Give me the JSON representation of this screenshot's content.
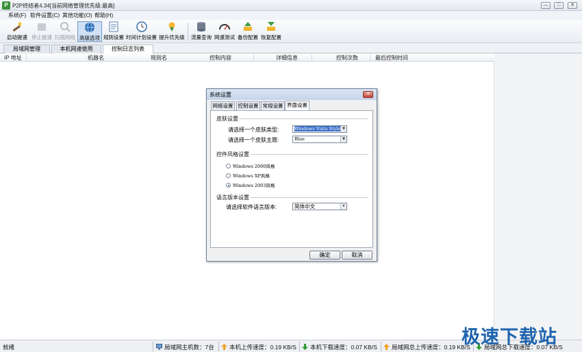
{
  "window": {
    "title": "P2P终结者4.34[当前网络管理优先级:最高]",
    "controls": {
      "minimize": "—",
      "maximize": "□",
      "close": "✕"
    }
  },
  "menu": [
    "系统(F)",
    "软件设置(C)",
    "其他功能(O)",
    "帮助(H)"
  ],
  "toolbar": [
    {
      "label": "启动提速",
      "icon": "wand-icon",
      "enabled": true
    },
    {
      "label": "停止提速",
      "icon": "stop-icon",
      "enabled": false
    },
    {
      "label": "扫描网络",
      "icon": "scan-icon",
      "enabled": false
    },
    {
      "label": "高级选项",
      "icon": "globe-icon",
      "enabled": true,
      "active": true
    },
    {
      "label": "规则设置",
      "icon": "rules-icon",
      "enabled": true
    },
    {
      "label": "时间计划设置",
      "icon": "clock-icon",
      "enabled": true
    },
    {
      "label": "提升优先级",
      "icon": "pin-icon",
      "enabled": true
    },
    {
      "label": "流量查询",
      "icon": "database-icon",
      "enabled": true
    },
    {
      "label": "网速测试",
      "icon": "speedometer-icon",
      "enabled": true
    },
    {
      "label": "备份配置",
      "icon": "backup-icon",
      "enabled": true
    },
    {
      "label": "恢复配置",
      "icon": "restore-icon",
      "enabled": true
    }
  ],
  "tabs": [
    {
      "label": "局域网管理"
    },
    {
      "label": "本机网速使用"
    },
    {
      "label": "控制日志列表",
      "selected": true
    }
  ],
  "columns": [
    "IP 地址",
    "机器名",
    "规则名",
    "控制内容",
    "详细信息",
    "控制次数",
    "最后控制时间"
  ],
  "dialog": {
    "title": "系统设置",
    "close": "✕",
    "tabs": [
      {
        "label": "网络设置"
      },
      {
        "label": "控制设置"
      },
      {
        "label": "常规设置"
      },
      {
        "label": "界面设置",
        "selected": true
      }
    ],
    "skin": {
      "group": "皮肤设置",
      "type_label": "请选择一个皮肤类型:",
      "type_value": "Windows Vista Style",
      "theme_label": "请选择一个皮肤主题:",
      "theme_value": "Blue"
    },
    "style": {
      "group": "控件风格设置",
      "options": [
        {
          "label": "Windows 2000风格",
          "checked": false
        },
        {
          "label": "Windows XP风格",
          "checked": false
        },
        {
          "label": "Windows 2003风格",
          "checked": true
        }
      ]
    },
    "language": {
      "group": "语言版本设置",
      "label": "请选择软件语言版本:",
      "value": "简体中文"
    },
    "ok": "确定",
    "cancel": "取消"
  },
  "status": {
    "ready": "就绪",
    "hosts": "局域网主机数：7台",
    "upload": "本机上传速度：0.19 KB/S",
    "download": "本机下载速度：0.07 KB/S",
    "lan_upload": "局域网总上传速度：0.19 KB/S",
    "lan_download": "局域网总下载速度：0.07 KB/S"
  },
  "watermark": "极速下载站",
  "colors": {
    "accent": "#1e64ad",
    "upload_arrow": "#f0a020",
    "download_arrow": "#2e9a2e"
  }
}
